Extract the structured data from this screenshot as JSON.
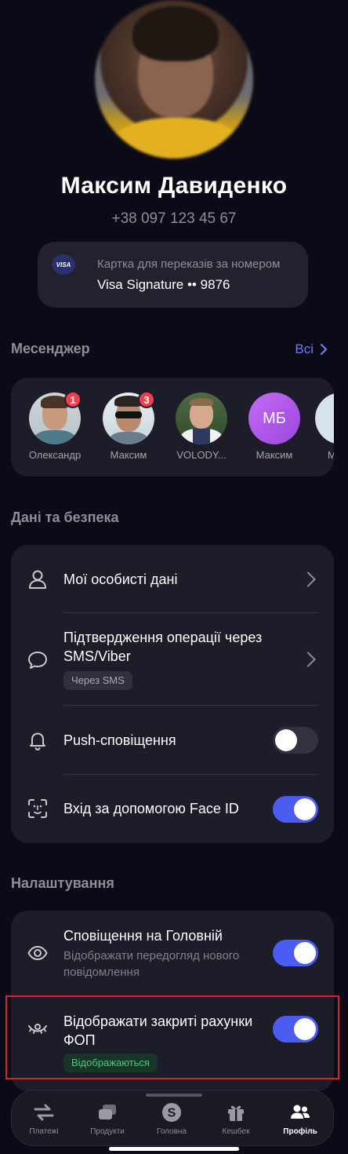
{
  "profile": {
    "name": "Максим Давиденко",
    "phone": "+38 097 123 45 67",
    "card": {
      "brand": "VISA",
      "caption": "Картка для переказів за номером",
      "number": "Visa Signature •• 9876"
    }
  },
  "messenger": {
    "title": "Месенджер",
    "all_label": "Всі",
    "contacts": [
      {
        "label": "Олександр",
        "badge": "1"
      },
      {
        "label": "Максим",
        "badge": "3"
      },
      {
        "label": "VOLODY...",
        "badge": ""
      },
      {
        "label": "Максим",
        "badge": "",
        "initials": "МБ"
      },
      {
        "label": "М",
        "badge": ""
      }
    ]
  },
  "security": {
    "title": "Дані та безпека",
    "personal_data": "Мої особисті дані",
    "confirm_title": "Підтвердження операції через SMS/Viber",
    "confirm_chip": "Через SMS",
    "push_title": "Push-сповіщення",
    "push_on": false,
    "faceid_title": "Вхід за допомогою Face ID",
    "faceid_on": true
  },
  "settings": {
    "title": "Налаштування",
    "home_notif_title": "Сповіщення на Головній",
    "home_notif_sub": "Відображати передогляд нового повідомлення",
    "home_notif_on": true,
    "closed_accounts_title": "Відображати закриті рахунки ФОП",
    "closed_accounts_chip": "Відображаються",
    "closed_accounts_on": true
  },
  "tabs": [
    {
      "label": "Платежі",
      "icon": "transfer-arrows-icon",
      "active": false
    },
    {
      "label": "Продукти",
      "icon": "cards-icon",
      "active": false
    },
    {
      "label": "Головна",
      "icon": "s-logo-icon",
      "active": false
    },
    {
      "label": "Кешбек",
      "icon": "gift-icon",
      "active": false
    },
    {
      "label": "Профіль",
      "icon": "people-icon",
      "active": true
    }
  ],
  "colors": {
    "background": "#0b0b18",
    "panel": "#1d1d29",
    "accent": "#4b5cf0",
    "link": "#6f79ff",
    "badge": "#f0404f",
    "highlight": "#d6242a"
  }
}
